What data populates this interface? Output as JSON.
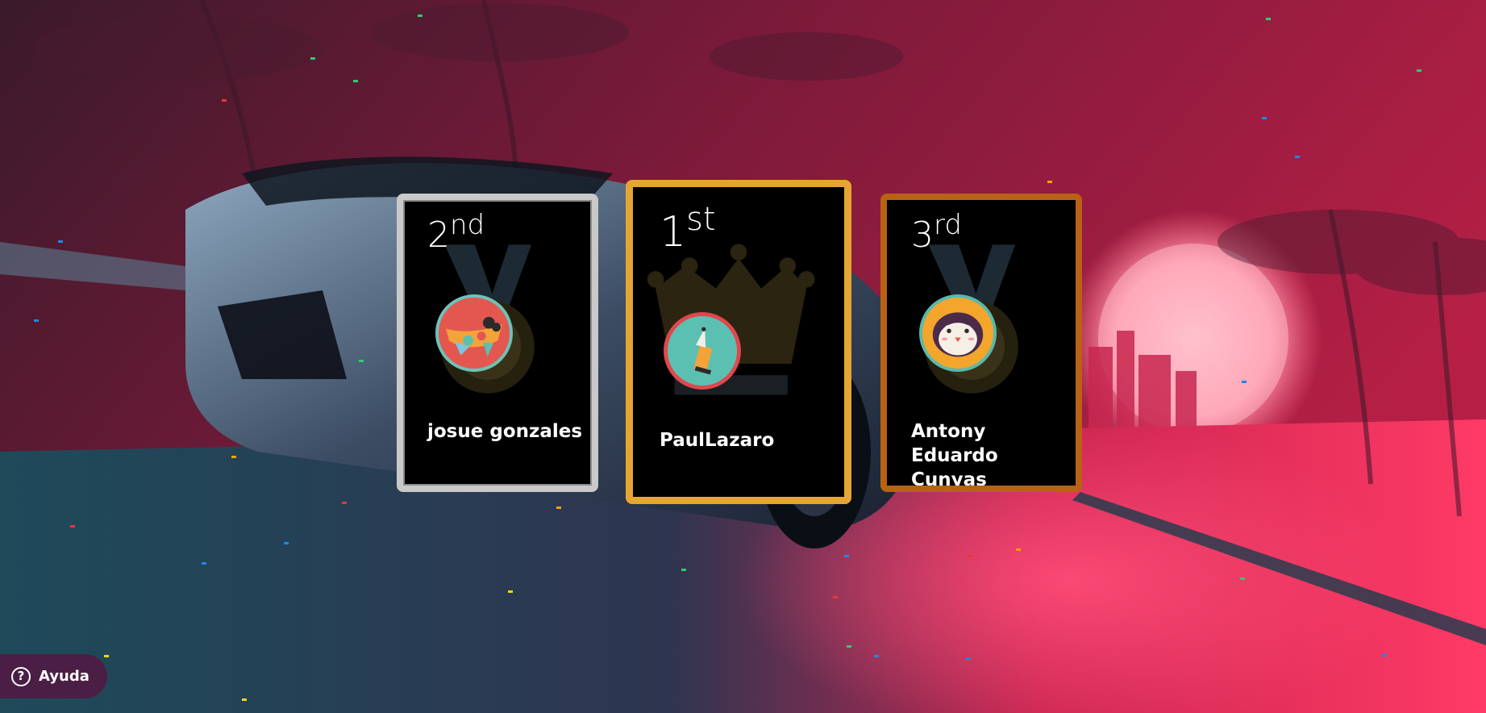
{
  "podium": {
    "second": {
      "rank_number": "2",
      "rank_suffix": "nd",
      "player_name": "josue gonzales",
      "avatar": "toy-plane-avatar",
      "border_color": "#c9c9c9"
    },
    "first": {
      "rank_number": "1",
      "rank_suffix": "st",
      "player_name": "PaulLazaro",
      "avatar": "pen-nib-avatar",
      "border_color": "#e4a533"
    },
    "third": {
      "rank_number": "3",
      "rank_suffix": "rd",
      "player_name": "Antony Eduardo Cunyas",
      "avatar": "penguin-avatar",
      "border_color": "#b86215"
    }
  },
  "help": {
    "label": "Ayuda",
    "icon": "question-mark-icon"
  },
  "background": {
    "scene": "neon sports car on road with palm trees at sunset",
    "accent_pink": "#e9355f",
    "accent_teal": "#2ea6b8"
  }
}
